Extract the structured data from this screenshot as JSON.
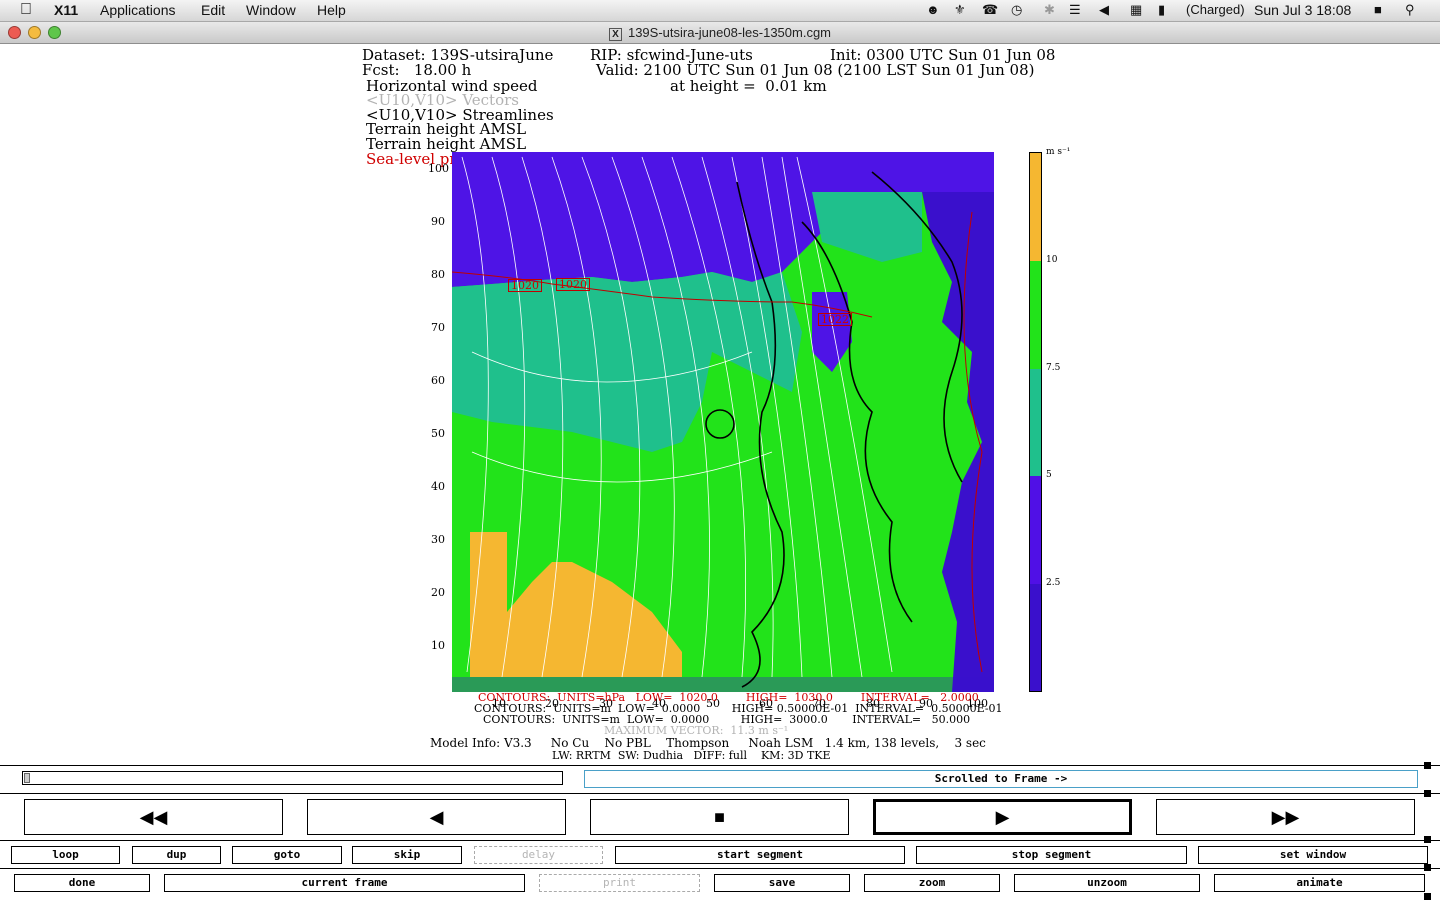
{
  "menubar": {
    "app_name": "X11",
    "items": [
      "Applications",
      "Edit",
      "Window",
      "Help"
    ],
    "battery_status": "(Charged)",
    "clock": "Sun Jul 3  18:08"
  },
  "window": {
    "title": "139S-utsira-june08-les-1350m.cgm",
    "badge": "X"
  },
  "header": {
    "dataset": "Dataset: 139S-utsiraJune",
    "rip": "RIP: sfcwind-June-uts",
    "init": "Init: 0300 UTC Sun 01 Jun 08",
    "fcst": "Fcst:   18.00 h",
    "valid": "Valid: 2100 UTC Sun 01 Jun 08 (2100 LST Sun 01 Jun 08)",
    "height": "at height =  0.01 km",
    "fields": [
      "Horizontal wind speed",
      "<U10,V10> Vectors",
      "<U10,V10> Streamlines",
      "Terrain height AMSL",
      "Terrain height AMSL",
      "Sea-level pressure"
    ]
  },
  "plot": {
    "y_ticks": [
      "100",
      "90",
      "80",
      "70",
      "60",
      "50",
      "40",
      "30",
      "20",
      "10"
    ],
    "x_ticks": [
      "10",
      "20",
      "30",
      "40",
      "50",
      "60",
      "70",
      "80",
      "90",
      "100"
    ],
    "isobar_labels": [
      "1020",
      "1020",
      "1022"
    ],
    "colors": {
      "orange": "#f5b731",
      "green": "#22e31a",
      "teal": "#1fc08c",
      "purple": "#4e14e6",
      "indigo": "#3a10cc"
    }
  },
  "colorbar": {
    "unit": "m s⁻¹",
    "levels": [
      "10",
      "7.5",
      "5",
      "2.5"
    ],
    "colors": [
      "#f5b731",
      "#22e31a",
      "#1fc08c",
      "#5010e6",
      "#3a10cc"
    ]
  },
  "footer": {
    "contours1": "CONTOURS:  UNITS=hPa   LOW=  1020.0        HIGH=  1030.0        INTERVAL=   2.0000",
    "contours2": "CONTOURS:  UNITS=m  LOW=  0.0000         HIGH= 0.50000E-01  INTERVAL=  0.50000E-01",
    "contours3": "CONTOURS:  UNITS=m  LOW=  0.0000         HIGH=  3000.0       INTERVAL=   50.000",
    "max_vector": "MAXIMUM VECTOR:  11.3 m s⁻¹",
    "model_info": "Model Info: V3.3     No Cu    No PBL    Thompson     Noah LSM   1.4 km, 138 levels,    3 sec",
    "model_info2": "LW: RRTM  SW: Dudhia   DIFF: full    KM: 3D TKE"
  },
  "status": {
    "frame_label": "Scrolled to Frame ->"
  },
  "transport": [
    "rewind",
    "step-back",
    "stop",
    "play",
    "fast-forward"
  ],
  "buttons_row1": [
    {
      "label": "loop",
      "enabled": true
    },
    {
      "label": "dup",
      "enabled": true
    },
    {
      "label": "goto",
      "enabled": true
    },
    {
      "label": "skip",
      "enabled": true
    },
    {
      "label": "delay",
      "enabled": false
    },
    {
      "label": "start segment",
      "enabled": true
    },
    {
      "label": "stop segment",
      "enabled": true
    },
    {
      "label": "set window",
      "enabled": true
    }
  ],
  "buttons_row2": [
    {
      "label": "done",
      "enabled": true
    },
    {
      "label": "current frame",
      "enabled": true
    },
    {
      "label": "print",
      "enabled": false
    },
    {
      "label": "save",
      "enabled": true
    },
    {
      "label": "zoom",
      "enabled": true
    },
    {
      "label": "unzoom",
      "enabled": true
    },
    {
      "label": "animate",
      "enabled": true
    }
  ]
}
